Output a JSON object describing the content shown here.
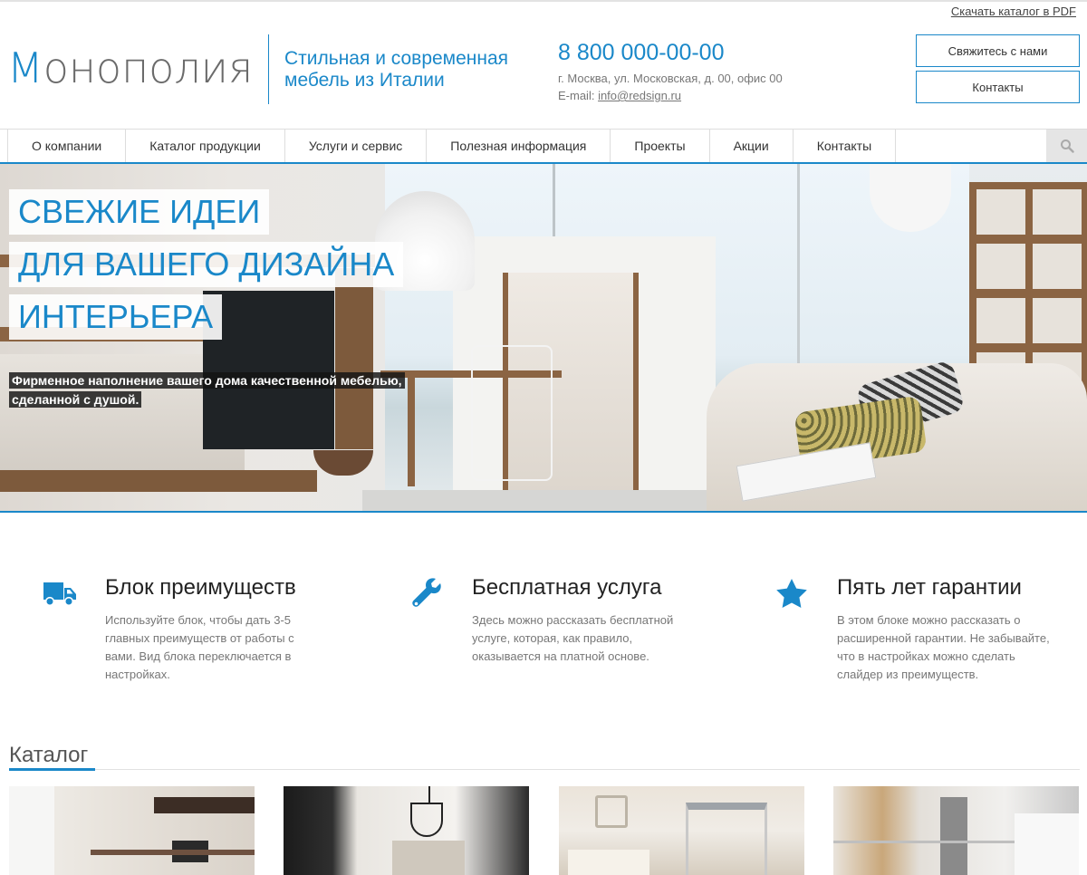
{
  "header": {
    "pdf_link": "Скачать каталог в PDF",
    "logo_first": "М",
    "logo_rest": "онополия",
    "slogan": "Стильная и современная мебель из Италии",
    "phone": "8 800 000-00-00",
    "address": "г. Москва, ул. Московская, д. 00, офис 00",
    "email_label": "E-mail: ",
    "email": "info@redsign.ru",
    "btn_contact_us": "Свяжитесь с нами",
    "btn_contacts": "Контакты"
  },
  "nav": {
    "items": [
      {
        "label": "О компании"
      },
      {
        "label": "Каталог продукции"
      },
      {
        "label": "Услуги и сервис"
      },
      {
        "label": "Полезная информация"
      },
      {
        "label": "Проекты"
      },
      {
        "label": "Акции"
      },
      {
        "label": "Контакты"
      }
    ],
    "search_icon": "search-icon"
  },
  "hero": {
    "title_lines": [
      "СВЕЖИЕ ИДЕИ",
      "ДЛЯ ВАШЕГО ДИЗАЙНА",
      "ИНТЕРЬЕРА"
    ],
    "subtitle": "Фирменное наполнение вашего дома качественной мебелью, сделанной с душой."
  },
  "benefits": [
    {
      "icon": "truck-icon",
      "title": "Блок преимуществ",
      "text": "Используйте блок, чтобы дать 3-5 главных преимуществ от работы с вами. Вид блока переключается в настройках."
    },
    {
      "icon": "wrench-icon",
      "title": "Бесплатная услуга",
      "text": "Здесь можно рассказать бесплатной услуге, которая, как правило, оказывается на платной основе."
    },
    {
      "icon": "star-icon",
      "title": "Пять лет гарантии",
      "text": "В этом блоке можно рассказать о расширенной гарантии. Не забывайте, что в настройках можно сделать слайдер из преимуществ."
    }
  ],
  "catalog": {
    "title": "Каталог"
  },
  "colors": {
    "accent": "#1a88c9",
    "text": "#333333",
    "muted": "#777777"
  }
}
